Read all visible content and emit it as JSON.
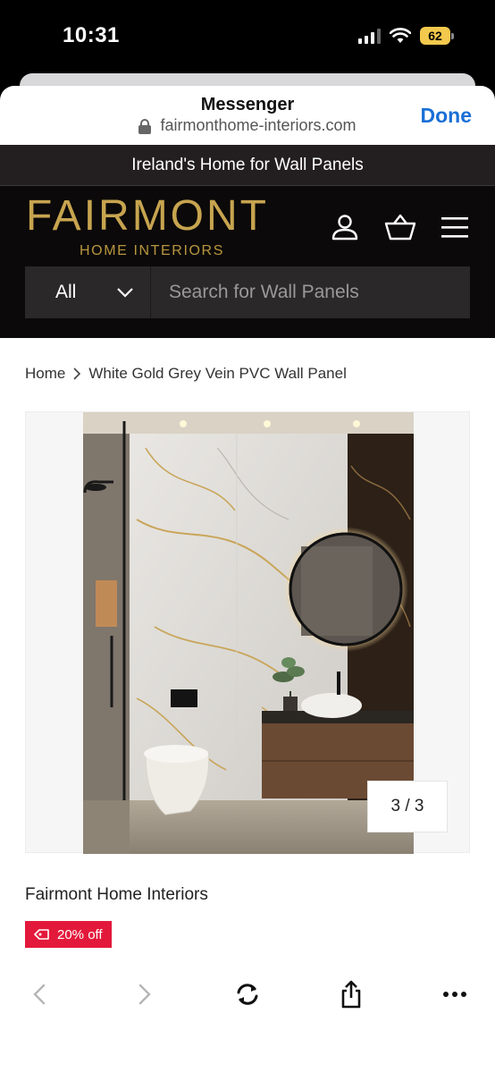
{
  "status_bar": {
    "time": "10:31",
    "battery": "62"
  },
  "browser": {
    "title": "Messenger",
    "url": "fairmonthome-interiors.com",
    "done_label": "Done"
  },
  "site": {
    "announcement": "Ireland's Home for Wall Panels",
    "logo_main": "FAIRMONT",
    "logo_sub": "HOME INTERIORS",
    "search": {
      "category": "All",
      "placeholder": "Search for Wall Panels"
    }
  },
  "breadcrumb": {
    "home": "Home",
    "current": "White Gold Grey Vein PVC Wall Panel"
  },
  "gallery": {
    "counter": "3 / 3"
  },
  "product": {
    "vendor": "Fairmont Home Interiors",
    "discount_badge": "20% off"
  },
  "colors": {
    "brand_gold": "#c7a44f",
    "header_bg": "#0b0909",
    "link_blue": "#1a6fd6",
    "badge_red": "#e3193b"
  },
  "icons": [
    "lock-icon",
    "account-icon",
    "cart-icon",
    "menu-icon",
    "chevron-down-icon",
    "tag-icon",
    "back-icon",
    "forward-icon",
    "reload-icon",
    "share-icon",
    "more-icon"
  ]
}
